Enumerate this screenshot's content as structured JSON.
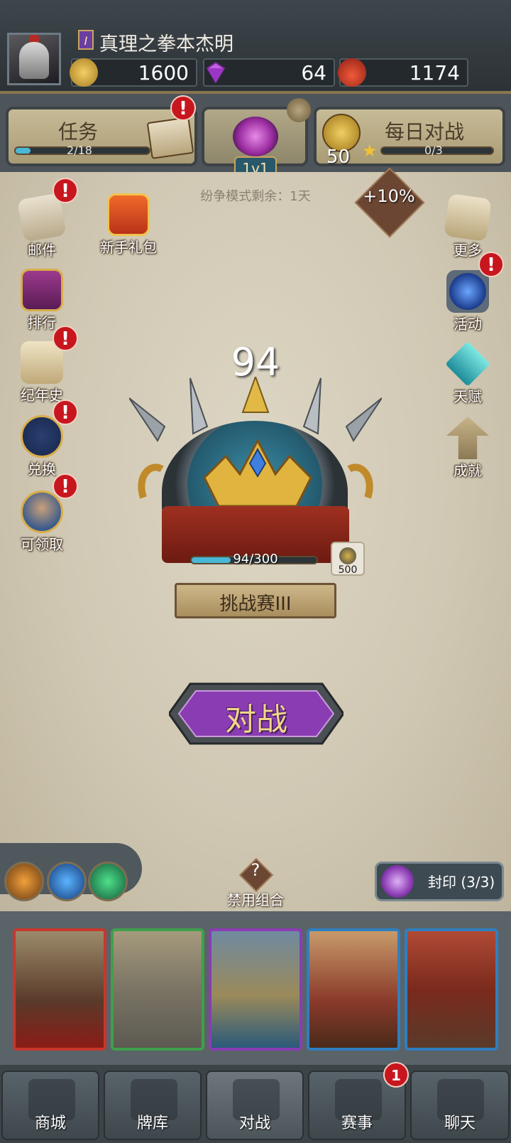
{
  "header": {
    "rank_level": "I",
    "player_name": "真理之拳本杰明",
    "resources": [
      {
        "icon": "gold-coin-icon",
        "value": "1600",
        "color": "#d8a93a"
      },
      {
        "icon": "gem-icon",
        "value": "64",
        "color": "#b548d6"
      },
      {
        "icon": "potion-icon",
        "value": "1174",
        "color": "#d8452e"
      }
    ]
  },
  "panels": {
    "quest": {
      "title": "任务",
      "progress_text": "2/18",
      "progress": 0.11
    },
    "mode": {
      "label": "1v1"
    },
    "daily": {
      "title": "每日对战",
      "coin_value": "50",
      "progress_text": "0/3",
      "progress": 0
    }
  },
  "mode_remaining": "纷争模式剩余：1天",
  "bonus_label": "+10%",
  "left_menu": [
    "邮件",
    "新手礼包",
    "排行",
    "纪年史",
    "兑换",
    "可领取"
  ],
  "right_menu": [
    "更多",
    "活动",
    "天赋",
    "成就"
  ],
  "league": {
    "score": "94",
    "progress_text": "94/300",
    "progress": 0.313,
    "reward_value": "500",
    "name": "挑战赛III"
  },
  "battle_button": "对战",
  "ban_combo": "禁用组合",
  "seal": "封印 (3/3)",
  "alert_symbol": "!",
  "nav": [
    {
      "label": "商城",
      "badge": ""
    },
    {
      "label": "牌库",
      "badge": ""
    },
    {
      "label": "对战",
      "badge": ""
    },
    {
      "label": "赛事",
      "badge": "1"
    },
    {
      "label": "聊天",
      "badge": ""
    }
  ],
  "colors": {
    "accent_purple": "#7b3aa8",
    "alert_red": "#c8161e",
    "progress_cyan": "#49b7d6",
    "parchment": "#d6cfbd"
  }
}
